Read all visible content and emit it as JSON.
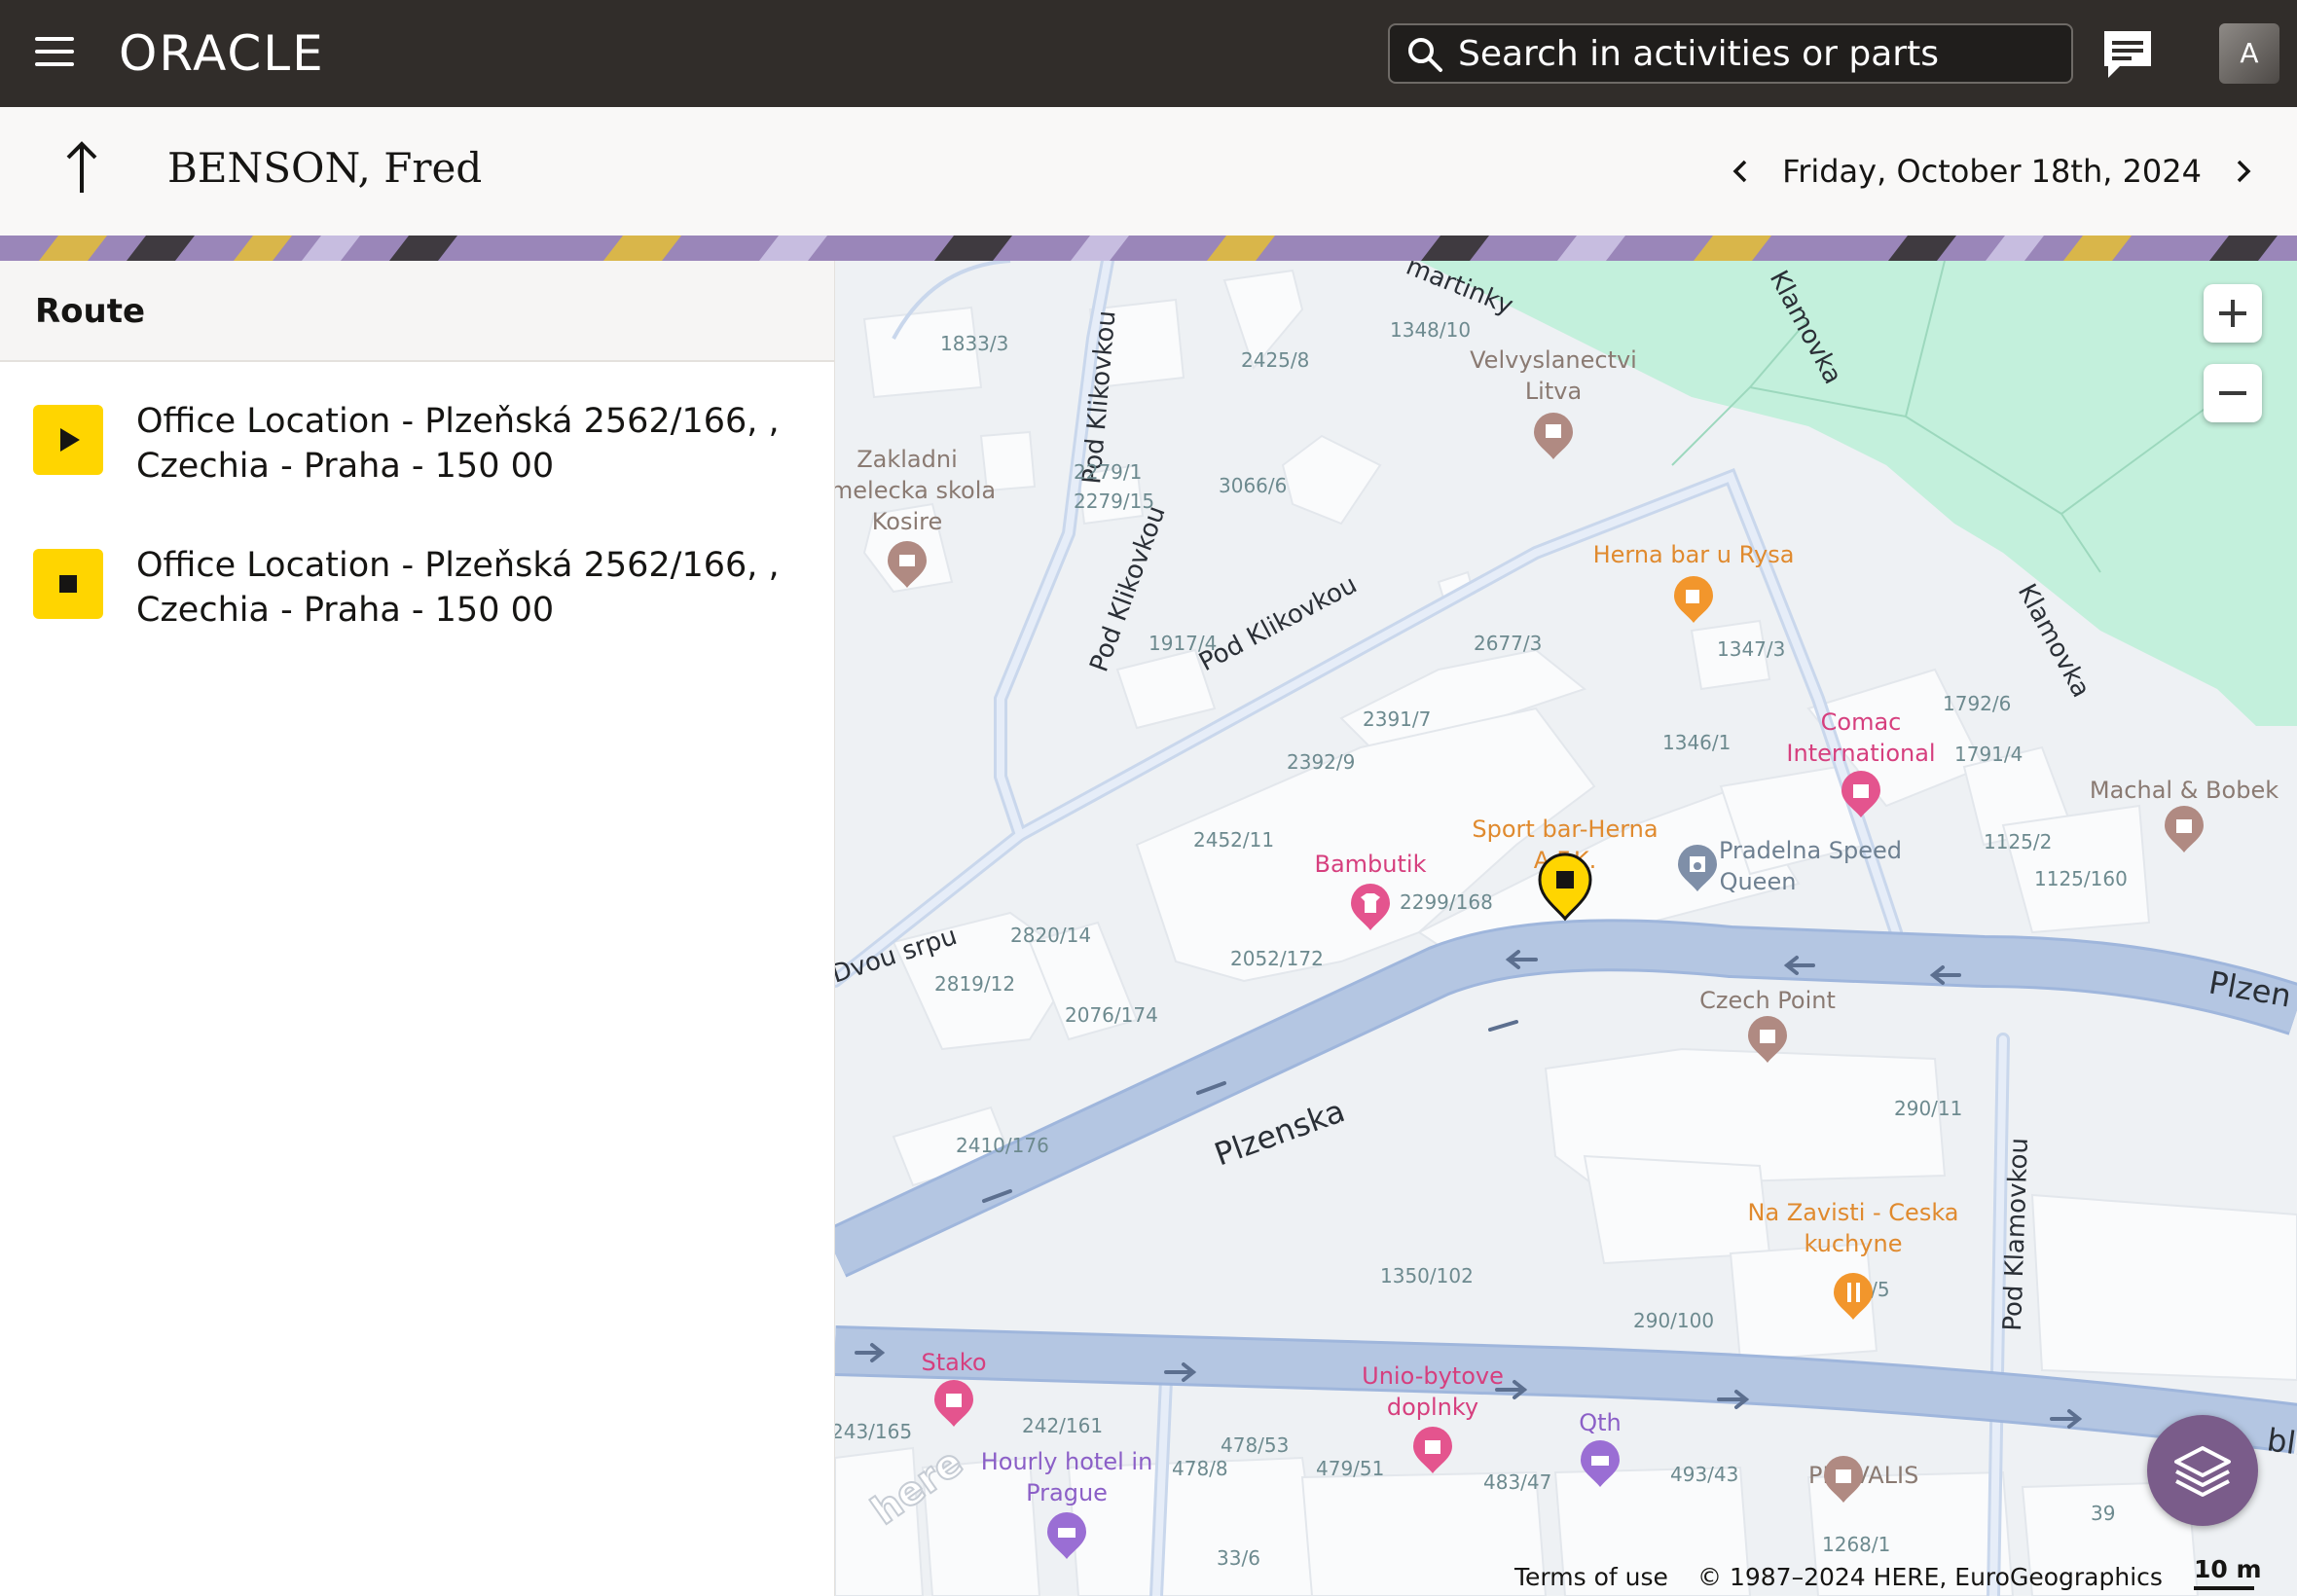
{
  "header": {
    "logo": "ORACLE",
    "search_placeholder": "Search in activities or parts",
    "avatar_initial": "A"
  },
  "titlebar": {
    "title": "BENSON, Fred",
    "date": "Friday, October 18th, 2024"
  },
  "route": {
    "heading": "Route",
    "items": [
      {
        "type": "start",
        "line1": "Office Location - Plzeňská 2562/166, ,",
        "line2": "Czechia - Praha - 150 00"
      },
      {
        "type": "end",
        "line1": "Office Location - Plzeňská 2562/166, ,",
        "line2": "Czechia - Praha - 150 00"
      }
    ]
  },
  "map": {
    "streets": {
      "pod_klikovkou_a": "Pod Klikovkou",
      "pod_klikovkou_b": "Pod Klikovkou",
      "pod_klikovkou_c": "Pod Klikovkou",
      "plzenska": "Plzenska",
      "plzen_cut": "Plzen",
      "klamovka_a": "Klamovka",
      "klamovka_b": "Klamovka",
      "dvou_srpu": "Dvou srpu",
      "martinky": "martinky",
      "pod_klamovkou": "Pod Klamovkou",
      "blic_cut": "blic"
    },
    "pois": {
      "velvyslanectvi": "Velvyslanectvi",
      "litva": "Litva",
      "zakladni1": "Zakladni",
      "zakladni2": "melecka skola",
      "zakladni3": "Kosire",
      "herna": "Herna bar u Rysa",
      "comac1": "Comac",
      "comac2": "International",
      "sport1": "Sport bar-Herna",
      "sport2": "A.F.K.",
      "bambutik": "Bambutik",
      "pradelna1": "Pradelna Speed",
      "pradelna2": "Queen",
      "machal": "Machal & Bobek",
      "czechpoint": "Czech Point",
      "nazavisti1": "Na Zavisti - Ceska",
      "nazavisti2": "kuchyne",
      "stako": "Stako",
      "unio1": "Unio-bytove",
      "unio2": "doplnky",
      "qth": "Qth",
      "hotel1": "Hourly hotel in",
      "hotel2": "Prague",
      "prevalis": "PREVALIS"
    },
    "addresses": [
      "1833/3",
      "2425/8",
      "1348/10",
      "2279/1",
      "2279/15",
      "3066/6",
      "1917/4",
      "2677/3",
      "1347/3",
      "2391/7",
      "2392/9",
      "1346/1",
      "1792/6",
      "1791/4",
      "2452/11",
      "2299/168",
      "1125/2",
      "1125/160",
      "2820/14",
      "2819/12",
      "2052/172",
      "2076/174",
      "290/11",
      "2410/176",
      "1350/102",
      "290/100",
      "473/5",
      "243/165",
      "242/161",
      "478/53",
      "478/8",
      "479/51",
      "483/47",
      "493/43",
      "39",
      "1268/1",
      "33/6"
    ],
    "watermark": "here",
    "terms": "Terms of use",
    "copyright": "© 1987–2024 HERE, EuroGeographics",
    "scale": "10 m"
  },
  "colors": {
    "topbar": "#312d2a",
    "accent_yellow": "#ffd500",
    "park": "#c3f0dc",
    "road": "#b4c6e2",
    "layers_button": "#7a5c8a"
  }
}
